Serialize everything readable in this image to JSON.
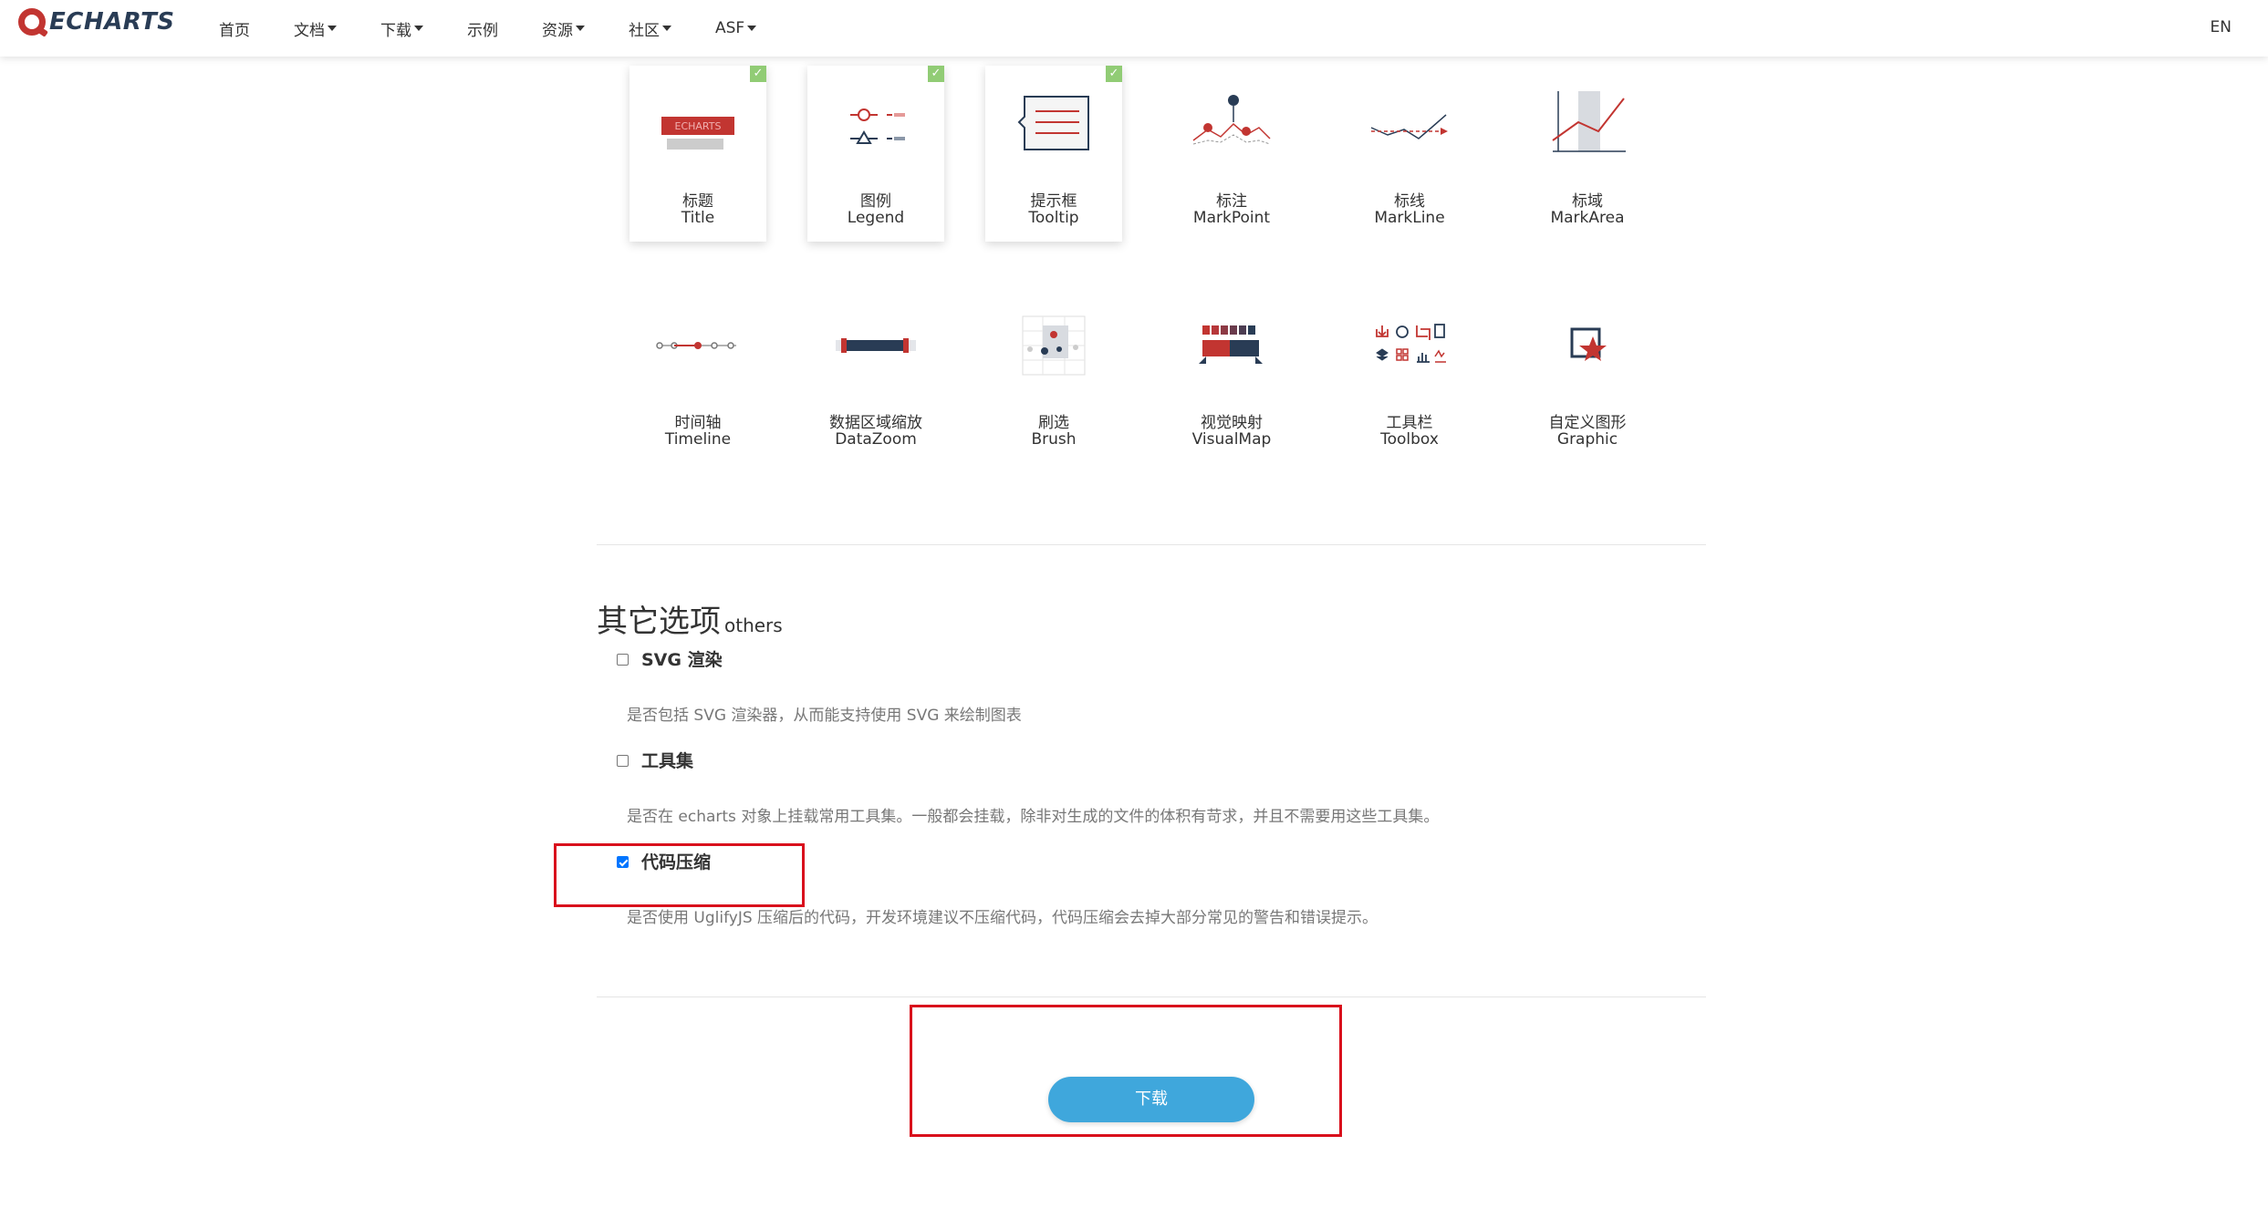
{
  "nav": {
    "logo_text": "ECHARTS",
    "items": [
      {
        "label": "首页",
        "dropdown": false
      },
      {
        "label": "文档",
        "dropdown": true
      },
      {
        "label": "下载",
        "dropdown": true
      },
      {
        "label": "示例",
        "dropdown": false
      },
      {
        "label": "资源",
        "dropdown": true
      },
      {
        "label": "社区",
        "dropdown": true
      },
      {
        "label": "ASF",
        "dropdown": true
      }
    ],
    "lang": "EN"
  },
  "components": [
    {
      "zh": "标题",
      "en": "Title",
      "selected": true,
      "icon": "title-icon",
      "thumb_text": "ECHARTS"
    },
    {
      "zh": "图例",
      "en": "Legend",
      "selected": true,
      "icon": "legend-icon"
    },
    {
      "zh": "提示框",
      "en": "Tooltip",
      "selected": true,
      "icon": "tooltip-icon"
    },
    {
      "zh": "标注",
      "en": "MarkPoint",
      "selected": false,
      "icon": "markpoint-icon"
    },
    {
      "zh": "标线",
      "en": "MarkLine",
      "selected": false,
      "icon": "markline-icon"
    },
    {
      "zh": "标域",
      "en": "MarkArea",
      "selected": false,
      "icon": "markarea-icon"
    },
    {
      "zh": "时间轴",
      "en": "Timeline",
      "selected": false,
      "icon": "timeline-icon"
    },
    {
      "zh": "数据区域缩放",
      "en": "DataZoom",
      "selected": false,
      "icon": "datazoom-icon"
    },
    {
      "zh": "刷选",
      "en": "Brush",
      "selected": false,
      "icon": "brush-icon"
    },
    {
      "zh": "视觉映射",
      "en": "VisualMap",
      "selected": false,
      "icon": "visualmap-icon"
    },
    {
      "zh": "工具栏",
      "en": "Toolbox",
      "selected": false,
      "icon": "toolbox-icon"
    },
    {
      "zh": "自定义图形",
      "en": "Graphic",
      "selected": false,
      "icon": "graphic-icon"
    }
  ],
  "check_mark": "✓",
  "others": {
    "title": "其它选项",
    "subtitle": "others",
    "options": [
      {
        "label": "SVG 渲染",
        "checked": false,
        "desc": "是否包括 SVG 渲染器，从而能支持使用 SVG 来绘制图表"
      },
      {
        "label": "工具集",
        "checked": false,
        "desc": "是否在 echarts 对象上挂载常用工具集。一般都会挂载，除非对生成的文件的体积有苛求，并且不需要用这些工具集。"
      },
      {
        "label": "代码压缩",
        "checked": true,
        "desc": "是否使用 UglifyJS 压缩后的代码，开发环境建议不压缩代码，代码压缩会去掉大部分常见的警告和错误提示。"
      }
    ]
  },
  "download_label": "下载",
  "colors": {
    "accent_red": "#c23531",
    "dark_blue": "#293c55",
    "button_blue": "#3fa7dc",
    "check_green": "#91cc75",
    "highlight_red": "#d9101c"
  }
}
